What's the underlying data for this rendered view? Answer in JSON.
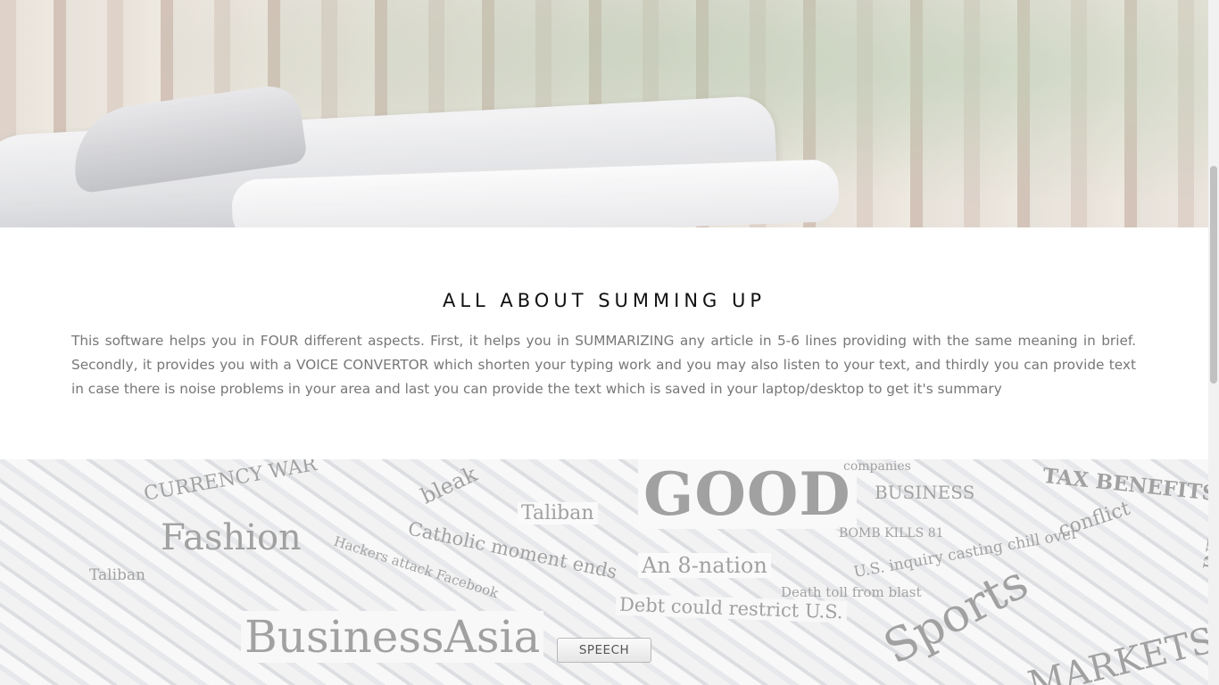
{
  "about": {
    "title": "ALL ABOUT SUMMING UP",
    "description": "This software helps you in FOUR different aspects. First, it helps you in SUMMARIZING any article in 5-6 lines providing with the same meaning in brief. Secondly, it provides you with a VOICE CONVERTOR which shorten your typing work and you may also listen to your text, and thirdly you can provide text in case there is noise problems in your area and last you can provide the text which is saved in your laptop/desktop to get it's summary"
  },
  "collage_words": {
    "good": "GOOD",
    "business_asia": "BusinessAsia",
    "fashion": "Fashion",
    "taliban": "Taliban",
    "nation": "An 8-nation",
    "debt": "Debt could restrict U.S.",
    "catholic": "Catholic moment ends",
    "hackers": "Hackers attack Facebook",
    "sports": "Sports",
    "markets": "MARKETS",
    "tax": "TAX BENEFITS",
    "business": "BUSINESS",
    "companies": "companies",
    "bomb": "BOMB KILLS 81",
    "inquiry": "U.S. inquiry casting chill over",
    "conflict": "conflict",
    "death": "Death toll from blast",
    "currency": "CURRENCY WAR",
    "bleak": "bleak",
    "taliban2": "Taliban",
    "interest": "INTEREST RA"
  },
  "speech_button": {
    "label": "SPEECH"
  }
}
